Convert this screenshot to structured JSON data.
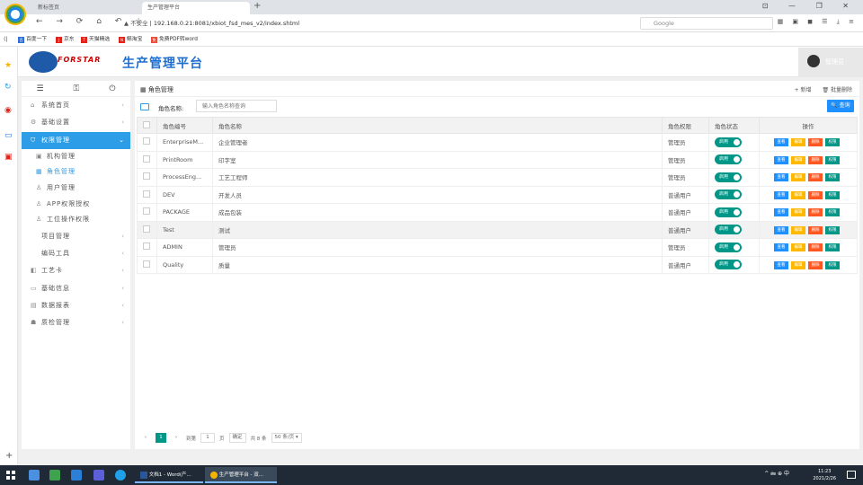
{
  "browser": {
    "tabs": [
      {
        "label": "新标签页"
      },
      {
        "label": "生产管理平台"
      }
    ],
    "tab_add": "+",
    "window_controls": "⊡ — ❐ ✕",
    "nav": "← → ⟳ ⌂ ↶ ☆",
    "url_warning": "▲ 不安全",
    "url": "192.168.0.21:8081/xbiot_fsd_mes_v2/index.shtml",
    "search_placeholder": "Google"
  },
  "bookmarks": [
    {
      "label": "百度一下",
      "color": "#2f6fd8"
    },
    {
      "label": "京东",
      "color": "#e2231a"
    },
    {
      "label": "天猫精选",
      "color": "#e2231a"
    },
    {
      "label": "鲸淘宝",
      "color": "#e2231a"
    },
    {
      "label": "免费PDF转word",
      "color": "#e84c3d"
    }
  ],
  "header": {
    "logo_text": "FORSTAR",
    "title": "生产管理平台",
    "user": "管理员"
  },
  "sidebar": {
    "items": [
      {
        "icon": "⌂",
        "label": "系统首页",
        "chevron": "‹"
      },
      {
        "icon": "⚙",
        "label": "基础设置",
        "chevron": "‹"
      },
      {
        "icon": "⛉",
        "label": "权限管理",
        "chevron": "⌄",
        "active": true
      },
      {
        "icon": "▣",
        "label": "机构管理",
        "sub": true
      },
      {
        "icon": "▦",
        "label": "角色管理",
        "sub": true,
        "selected": true
      },
      {
        "icon": "♙",
        "label": "用户管理",
        "sub": true
      },
      {
        "icon": "♙",
        "label": "APP权限授权",
        "sub": true
      },
      {
        "icon": "♙",
        "label": "工位操作权限",
        "sub": true
      },
      {
        "icon": "",
        "label": "项目管理",
        "chevron": "‹"
      },
      {
        "icon": "",
        "label": "编码工具",
        "chevron": "‹"
      },
      {
        "icon": "◧",
        "label": "工艺卡",
        "chevron": "‹"
      },
      {
        "icon": "▭",
        "label": "基础信息",
        "chevron": "‹"
      },
      {
        "icon": "▤",
        "label": "数据报表",
        "chevron": "‹"
      },
      {
        "icon": "☗",
        "label": "质检管理",
        "chevron": "‹"
      }
    ]
  },
  "main": {
    "title": "角色管理",
    "add_label": "+ 新增",
    "batch_delete_label": "🗑 批量删除",
    "filter_label": "角色名称:",
    "filter_placeholder": "输入角色名称查询",
    "query_label": "🔍 查询"
  },
  "table": {
    "columns": [
      "角色编号",
      "角色名称",
      "角色权限",
      "角色状态",
      "操作"
    ],
    "rows": [
      {
        "code": "EnterpriseM...",
        "name": "企业管理者",
        "perm": "管理员",
        "status": "启用"
      },
      {
        "code": "PrintRoom",
        "name": "印字室",
        "perm": "管理员",
        "status": "启用"
      },
      {
        "code": "ProcessEng...",
        "name": "工艺工程师",
        "perm": "管理员",
        "status": "启用"
      },
      {
        "code": "DEV",
        "name": "开发人员",
        "perm": "普通用户",
        "status": "启用"
      },
      {
        "code": "PACKAGE",
        "name": "成品包装",
        "perm": "普通用户",
        "status": "启用"
      },
      {
        "code": "Test",
        "name": "测试",
        "perm": "普通用户",
        "status": "启用",
        "highlighted": true
      },
      {
        "code": "ADMIN",
        "name": "管理员",
        "perm": "管理员",
        "status": "启用"
      },
      {
        "code": "Quality",
        "name": "质量",
        "perm": "普通用户",
        "status": "启用"
      }
    ],
    "ops": [
      "查看",
      "编辑",
      "删除",
      "权限"
    ]
  },
  "pager": {
    "prev": "‹",
    "current": "1",
    "next": "›",
    "goto_label": "到第",
    "goto_value": "1",
    "page_unit": "页",
    "confirm": "确定",
    "total": "共 8 条",
    "page_size": "50 条/页"
  },
  "taskbar": {
    "apps": [
      {
        "label": "文档1 - Word(产..."
      },
      {
        "label": "生产管理平台 - 双..."
      }
    ],
    "tray": "^ 🖮 ⊕ 中",
    "time": "11:23",
    "date": "2021/2/26"
  }
}
